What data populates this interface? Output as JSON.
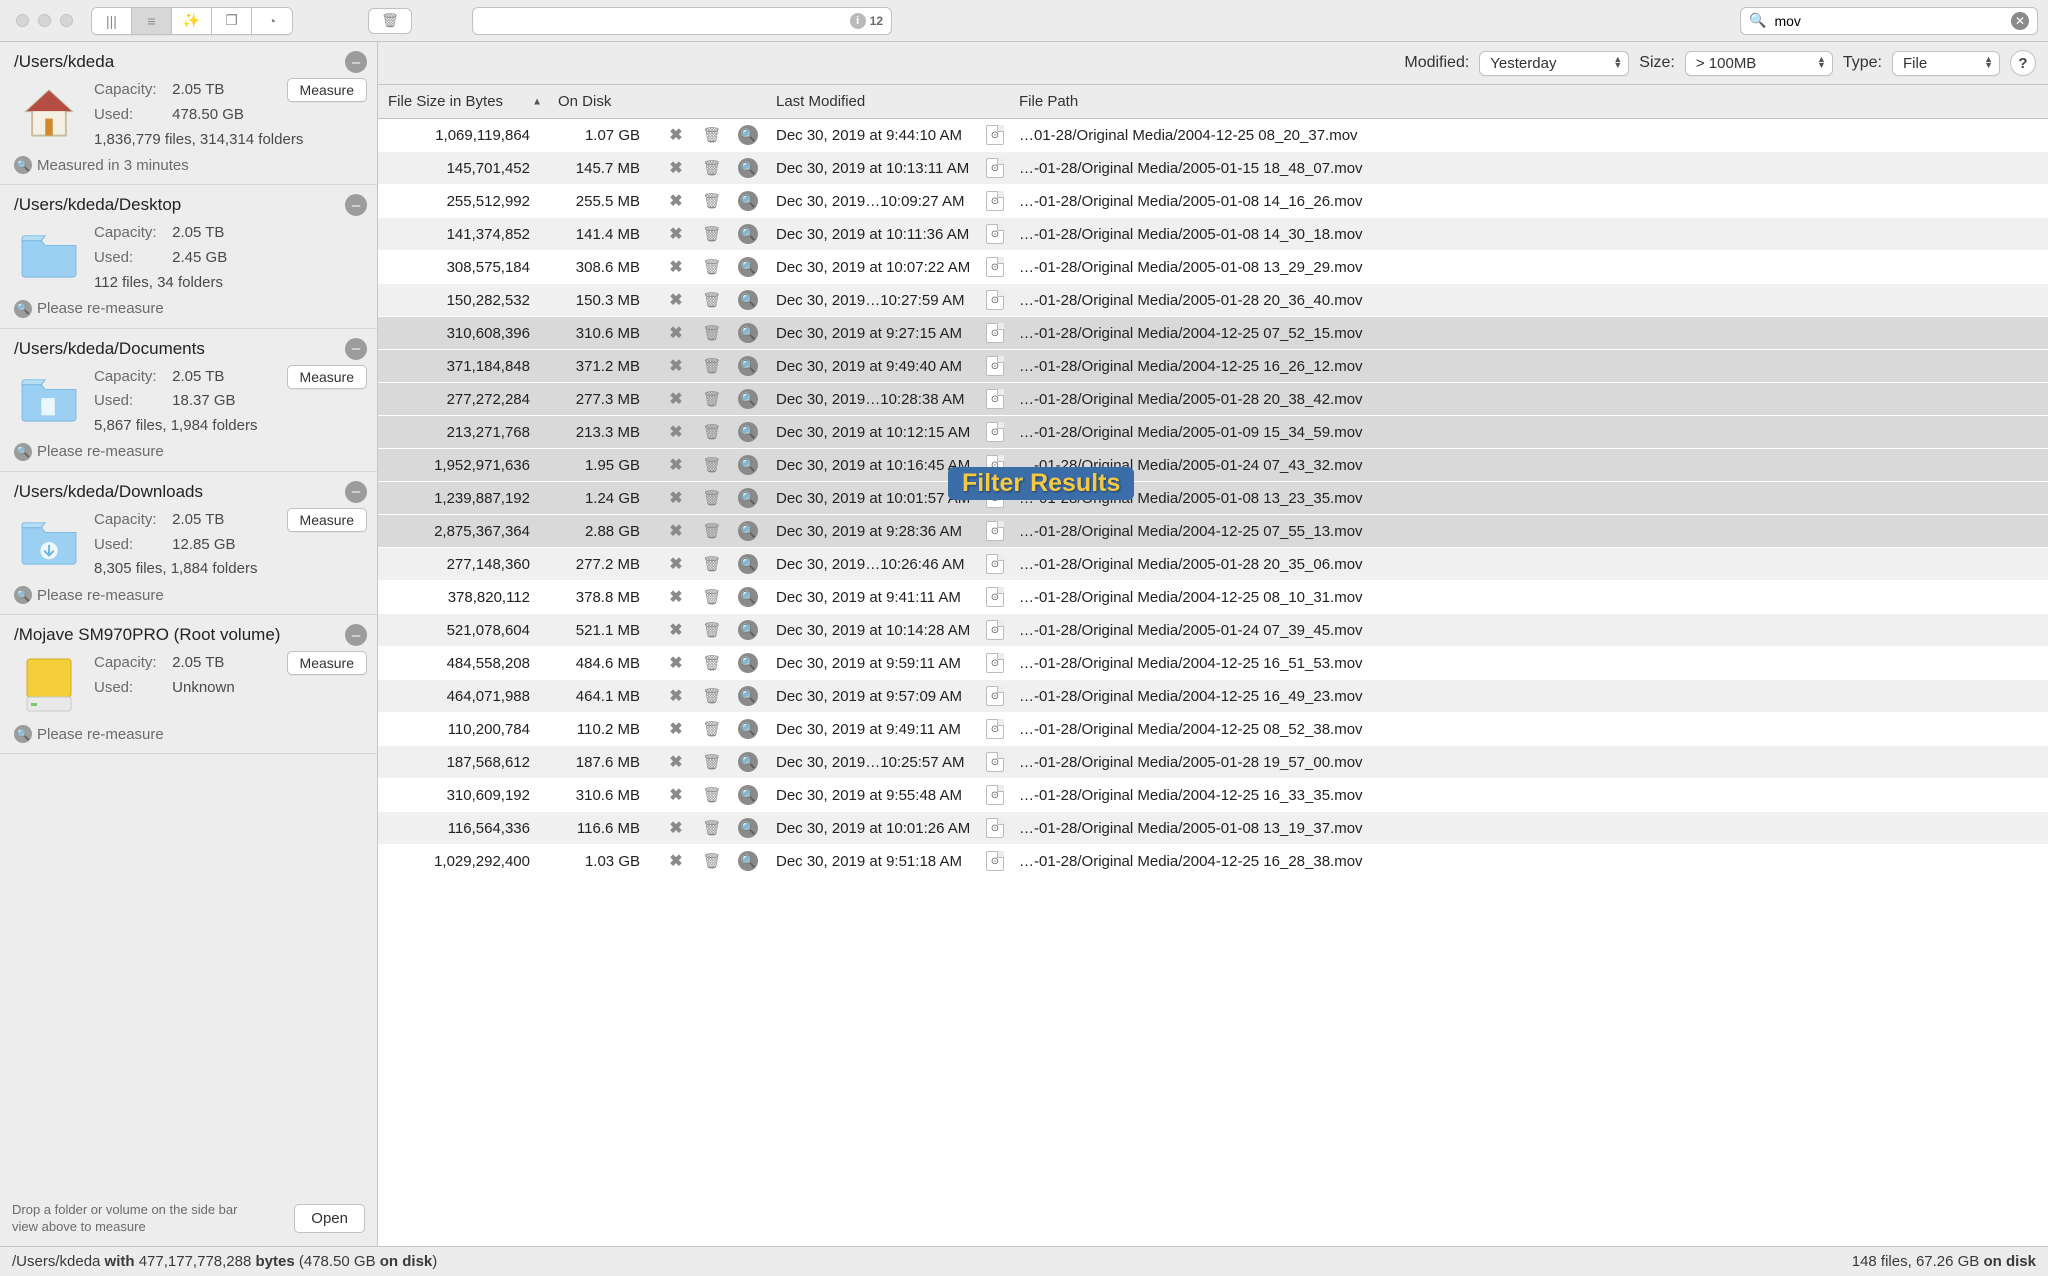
{
  "toolbar": {
    "search_placeholder": "",
    "search_badge_count": "12",
    "filter_value": "mov"
  },
  "filterbar": {
    "modified_label": "Modified:",
    "modified_value": "Yesterday",
    "size_label": "Size:",
    "size_value": "> 100MB",
    "type_label": "Type:",
    "type_value": "File"
  },
  "columns": {
    "size": "File Size in Bytes",
    "disk": "On Disk",
    "modified": "Last Modified",
    "path": "File Path"
  },
  "overlay_text": "Filter Results",
  "sidebar": {
    "hint": "Drop a folder or volume on the side bar view above to measure",
    "open_label": "Open",
    "measure_label": "Measure",
    "volumes": [
      {
        "path": "/Users/kdeda",
        "capacity": "2.05 TB",
        "used": "478.50 GB",
        "files_folders": "1,836,779 files, 314,314 folders",
        "footer": "Measured in 3 minutes",
        "show_measure": true,
        "icon": "home"
      },
      {
        "path": "/Users/kdeda/Desktop",
        "capacity": "2.05 TB",
        "used": "2.45 GB",
        "files_folders": "112 files, 34 folders",
        "footer": "Please re-measure",
        "show_measure": false,
        "icon": "folder"
      },
      {
        "path": "/Users/kdeda/Documents",
        "capacity": "2.05 TB",
        "used": "18.37 GB",
        "files_folders": "5,867 files, 1,984 folders",
        "footer": "Please re-measure",
        "show_measure": true,
        "icon": "documents"
      },
      {
        "path": "/Users/kdeda/Downloads",
        "capacity": "2.05 TB",
        "used": "12.85 GB",
        "files_folders": "8,305 files, 1,884 folders",
        "footer": "Please re-measure",
        "show_measure": true,
        "icon": "downloads"
      },
      {
        "path": "/Mojave SM970PRO (Root volume)",
        "capacity": "2.05 TB",
        "used": "Unknown",
        "files_folders": "",
        "footer": "Please re-measure",
        "show_measure": true,
        "icon": "volume"
      }
    ]
  },
  "rows": [
    {
      "bytes": "1,069,119,864",
      "disk": "1.07 GB",
      "mod": "Dec 30, 2019 at 9:44:10 AM",
      "path": "…01-28/Original Media/2004-12-25 08_20_37.mov",
      "sel": false
    },
    {
      "bytes": "145,701,452",
      "disk": "145.7 MB",
      "mod": "Dec 30, 2019 at 10:13:11 AM",
      "path": "…-01-28/Original Media/2005-01-15 18_48_07.mov",
      "sel": false
    },
    {
      "bytes": "255,512,992",
      "disk": "255.5 MB",
      "mod": "Dec 30, 2019…10:09:27 AM",
      "path": "…-01-28/Original Media/2005-01-08 14_16_26.mov",
      "sel": false
    },
    {
      "bytes": "141,374,852",
      "disk": "141.4 MB",
      "mod": "Dec 30, 2019 at 10:11:36 AM",
      "path": "…-01-28/Original Media/2005-01-08 14_30_18.mov",
      "sel": false
    },
    {
      "bytes": "308,575,184",
      "disk": "308.6 MB",
      "mod": "Dec 30, 2019 at 10:07:22 AM",
      "path": "…-01-28/Original Media/2005-01-08 13_29_29.mov",
      "sel": false
    },
    {
      "bytes": "150,282,532",
      "disk": "150.3 MB",
      "mod": "Dec 30, 2019…10:27:59 AM",
      "path": "…-01-28/Original Media/2005-01-28 20_36_40.mov",
      "sel": false
    },
    {
      "bytes": "310,608,396",
      "disk": "310.6 MB",
      "mod": "Dec 30, 2019 at 9:27:15 AM",
      "path": "…-01-28/Original Media/2004-12-25 07_52_15.mov",
      "sel": true
    },
    {
      "bytes": "371,184,848",
      "disk": "371.2 MB",
      "mod": "Dec 30, 2019 at 9:49:40 AM",
      "path": "…-01-28/Original Media/2004-12-25 16_26_12.mov",
      "sel": true
    },
    {
      "bytes": "277,272,284",
      "disk": "277.3 MB",
      "mod": "Dec 30, 2019…10:28:38 AM",
      "path": "…-01-28/Original Media/2005-01-28 20_38_42.mov",
      "sel": true
    },
    {
      "bytes": "213,271,768",
      "disk": "213.3 MB",
      "mod": "Dec 30, 2019 at 10:12:15 AM",
      "path": "…-01-28/Original Media/2005-01-09 15_34_59.mov",
      "sel": true
    },
    {
      "bytes": "1,952,971,636",
      "disk": "1.95 GB",
      "mod": "Dec 30, 2019 at 10:16:45 AM",
      "path": "…-01-28/Original Media/2005-01-24 07_43_32.mov",
      "sel": true
    },
    {
      "bytes": "1,239,887,192",
      "disk": "1.24 GB",
      "mod": "Dec 30, 2019 at 10:01:57 AM",
      "path": "…-01-28/Original Media/2005-01-08 13_23_35.mov",
      "sel": true
    },
    {
      "bytes": "2,875,367,364",
      "disk": "2.88 GB",
      "mod": "Dec 30, 2019 at 9:28:36 AM",
      "path": "…-01-28/Original Media/2004-12-25 07_55_13.mov",
      "sel": true
    },
    {
      "bytes": "277,148,360",
      "disk": "277.2 MB",
      "mod": "Dec 30, 2019…10:26:46 AM",
      "path": "…-01-28/Original Media/2005-01-28 20_35_06.mov",
      "sel": false
    },
    {
      "bytes": "378,820,112",
      "disk": "378.8 MB",
      "mod": "Dec 30, 2019 at 9:41:11 AM",
      "path": "…-01-28/Original Media/2004-12-25 08_10_31.mov",
      "sel": false
    },
    {
      "bytes": "521,078,604",
      "disk": "521.1 MB",
      "mod": "Dec 30, 2019 at 10:14:28 AM",
      "path": "…-01-28/Original Media/2005-01-24 07_39_45.mov",
      "sel": false
    },
    {
      "bytes": "484,558,208",
      "disk": "484.6 MB",
      "mod": "Dec 30, 2019 at 9:59:11 AM",
      "path": "…-01-28/Original Media/2004-12-25 16_51_53.mov",
      "sel": false
    },
    {
      "bytes": "464,071,988",
      "disk": "464.1 MB",
      "mod": "Dec 30, 2019 at 9:57:09 AM",
      "path": "…-01-28/Original Media/2004-12-25 16_49_23.mov",
      "sel": false
    },
    {
      "bytes": "110,200,784",
      "disk": "110.2 MB",
      "mod": "Dec 30, 2019 at 9:49:11 AM",
      "path": "…-01-28/Original Media/2004-12-25 08_52_38.mov",
      "sel": false
    },
    {
      "bytes": "187,568,612",
      "disk": "187.6 MB",
      "mod": "Dec 30, 2019…10:25:57 AM",
      "path": "…-01-28/Original Media/2005-01-28 19_57_00.mov",
      "sel": false
    },
    {
      "bytes": "310,609,192",
      "disk": "310.6 MB",
      "mod": "Dec 30, 2019 at 9:55:48 AM",
      "path": "…-01-28/Original Media/2004-12-25 16_33_35.mov",
      "sel": false
    },
    {
      "bytes": "116,564,336",
      "disk": "116.6 MB",
      "mod": "Dec 30, 2019 at 10:01:26 AM",
      "path": "…-01-28/Original Media/2005-01-08 13_19_37.mov",
      "sel": false
    },
    {
      "bytes": "1,029,292,400",
      "disk": "1.03 GB",
      "mod": "Dec 30, 2019 at 9:51:18 AM",
      "path": "…-01-28/Original Media/2004-12-25 16_28_38.mov",
      "sel": false
    }
  ],
  "status": {
    "left_prefix": "/Users/kdeda ",
    "left_with": "with",
    "left_bytes": " 477,177,778,288 ",
    "left_bytes_word": "bytes",
    "left_paren": " (478.50 GB ",
    "left_ondisk": "on disk",
    "left_close": ")",
    "right_files": "148 files, 67.26 GB ",
    "right_ondisk": "on disk"
  }
}
